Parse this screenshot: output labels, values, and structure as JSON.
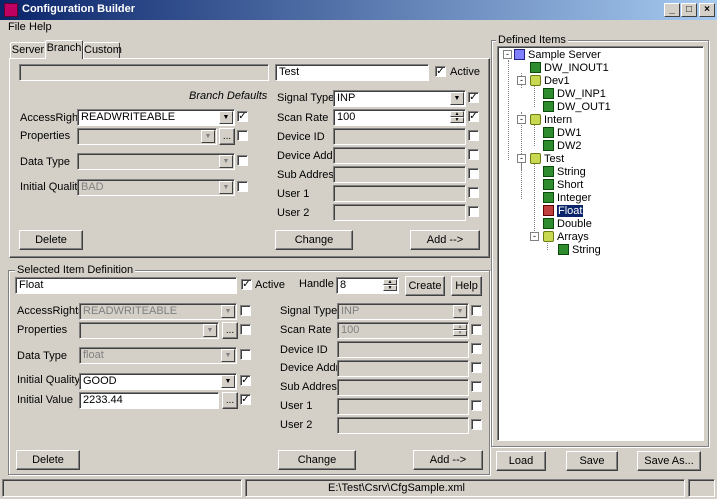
{
  "window": {
    "title": "Configuration Builder"
  },
  "menu": [
    "File",
    "Help"
  ],
  "tabs": [
    {
      "label": "Server"
    },
    {
      "label": "Branch"
    },
    {
      "label": "Custom"
    }
  ],
  "branch": {
    "path_value": "",
    "name_value": "Test",
    "active_label": "Active",
    "active_checked": "✓",
    "branch_defaults_label": "Branch Defaults",
    "access_rights_label": "AccessRights",
    "access_rights_value": "READWRITEABLE",
    "access_rights_checked": "✓",
    "properties_label": "Properties",
    "data_type_label": "Data Type",
    "initial_quality_label": "Initial Quality",
    "initial_quality_value": "BAD",
    "signal_type_label": "Signal Type",
    "signal_type_value": "INP",
    "signal_type_checked": "✓",
    "scan_rate_label": "Scan Rate",
    "scan_rate_value": "100",
    "scan_rate_checked": "✓",
    "device_id_label": "Device ID",
    "device_addr_label": "Device Addr",
    "sub_address_label": "Sub Address",
    "user1_label": "User 1",
    "user2_label": "User 2",
    "delete_label": "Delete",
    "change_label": "Change",
    "add_label": "Add   -->"
  },
  "selected": {
    "group_label": "Selected Item Definition",
    "name_value": "Float",
    "active_label": "Active",
    "active_checked": "✓",
    "handle_label": "Handle",
    "handle_value": "8",
    "create_label": "Create",
    "help_label": "Help",
    "access_rights_label": "AccessRights",
    "access_rights_value": "READWRITEABLE",
    "properties_label": "Properties",
    "data_type_label": "Data Type",
    "data_type_value": "float",
    "initial_quality_label": "Initial Quality",
    "initial_quality_value": "GOOD",
    "initial_quality_checked": "✓",
    "initial_value_label": "Initial Value",
    "initial_value_value": "2233.44",
    "initial_value_checked": "✓",
    "signal_type_label": "Signal Type",
    "signal_type_value": "INP",
    "scan_rate_label": "Scan Rate",
    "scan_rate_value": "100",
    "device_id_label": "Device ID",
    "device_addr_label": "Device Addr",
    "sub_address_label": "Sub Address",
    "user1_label": "User 1",
    "user2_label": "User 2",
    "delete_label": "Delete",
    "change_label": "Change",
    "add_label": "Add   -->"
  },
  "defined": {
    "group_label": "Defined Items",
    "tree": [
      {
        "label": "Sample Server"
      },
      {
        "label": "DW_INOUT1"
      },
      {
        "label": "Dev1"
      },
      {
        "label": "DW_INP1"
      },
      {
        "label": "DW_OUT1"
      },
      {
        "label": "Intern"
      },
      {
        "label": "DW1"
      },
      {
        "label": "DW2"
      },
      {
        "label": "Test"
      },
      {
        "label": "String"
      },
      {
        "label": "Short"
      },
      {
        "label": "Integer"
      },
      {
        "label": "Float"
      },
      {
        "label": "Double"
      },
      {
        "label": "Arrays"
      },
      {
        "label": "String"
      }
    ],
    "load_label": "Load",
    "save_label": "Save",
    "save_as_label": "Save As..."
  },
  "status": {
    "path": "E:\\Test\\Csrv\\CfgSample.xml"
  },
  "ellipsis": "...",
  "combo_arrow": "▼",
  "colors": {
    "titlebar": "#0a246a",
    "selection": "#0a246a"
  }
}
